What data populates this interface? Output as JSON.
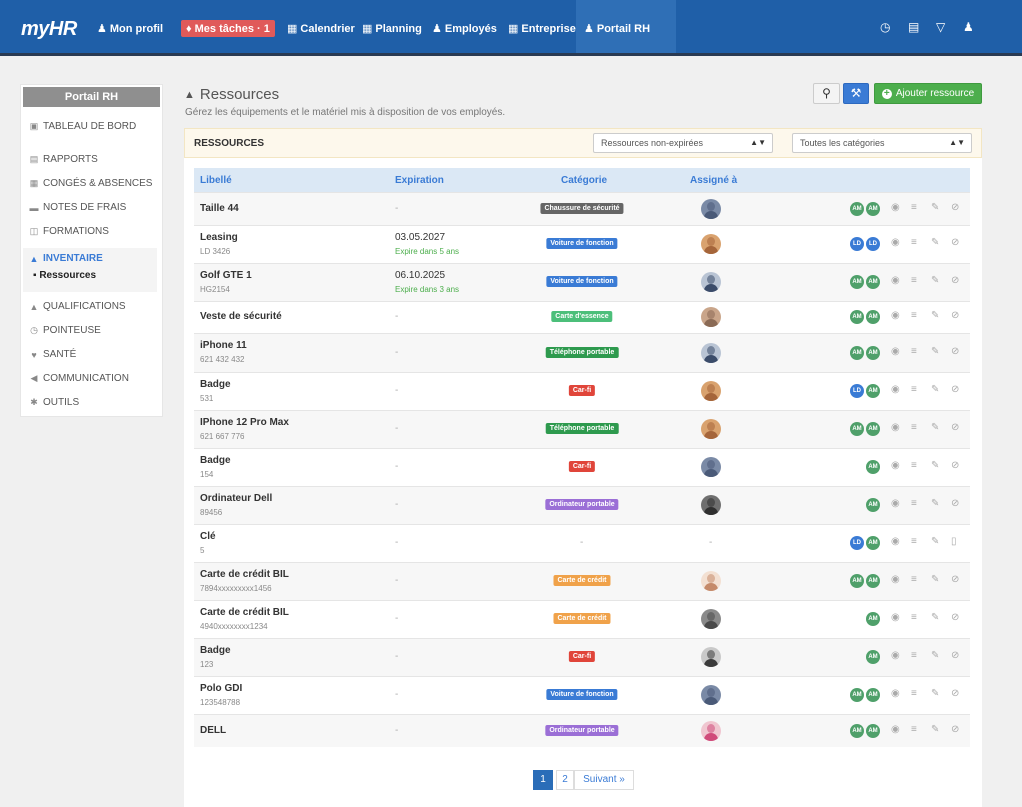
{
  "nav": {
    "logo": "myHR",
    "items": [
      {
        "label": "Mon profil",
        "icon": "user-icon"
      },
      {
        "label": "Mes tâches · 1",
        "icon": "bell-icon"
      },
      {
        "label": "Calendrier",
        "icon": "calendar-icon"
      },
      {
        "label": "Planning",
        "icon": "planning-icon"
      },
      {
        "label": "Employés",
        "icon": "users-icon"
      },
      {
        "label": "Entreprise",
        "icon": "building-icon"
      },
      {
        "label": "Portail RH",
        "icon": "hr-portal-icon"
      }
    ],
    "right_icons": [
      "alarm-icon",
      "clipboard-icon",
      "filter-icon",
      "user-icon"
    ]
  },
  "sidebar": {
    "title": "Portail RH",
    "items": [
      {
        "label": "TABLEAU DE BORD"
      },
      {
        "label": "RAPPORTS"
      },
      {
        "label": "CONGÉS & ABSENCES"
      },
      {
        "label": "NOTES DE FRAIS"
      },
      {
        "label": "FORMATIONS"
      },
      {
        "label": "INVENTAIRE"
      },
      {
        "label": "QUALIFICATIONS"
      },
      {
        "label": "POINTEUSE"
      },
      {
        "label": "SANTÉ"
      },
      {
        "label": "COMMUNICATION"
      },
      {
        "label": "OUTILS"
      }
    ],
    "sub_item": "Ressources"
  },
  "header": {
    "title": "Ressources",
    "subtitle": "Gérez les équipements et le matériel mis à disposition de vos employés.",
    "add_button": "Ajouter ressource"
  },
  "panel": {
    "title": "RESSOURCES",
    "filter_status": "Ressources non-expirées",
    "filter_category": "Toutes les catégories"
  },
  "table": {
    "columns": [
      "Libellé",
      "Expiration",
      "Catégorie",
      "Assigné à"
    ],
    "rows": [
      {
        "name": "Taille 44",
        "sub": "",
        "exp": "-",
        "exp2": "",
        "cat": "Chaussure de sécurité",
        "cat_color": "#666666",
        "chips": [
          "AM",
          "AM"
        ],
        "last_icon": "ban"
      },
      {
        "name": "Leasing",
        "sub": "LD 3426",
        "exp": "03.05.2027",
        "exp2": "Expire dans 5 ans",
        "cat": "Voiture de fonction",
        "cat_color": "#3a7bd5",
        "chips": [
          "LD",
          "LD"
        ],
        "last_icon": "ban"
      },
      {
        "name": "Golf GTE 1",
        "sub": "HG2154",
        "exp": "06.10.2025",
        "exp2": "Expire dans 3 ans",
        "cat": "Voiture de fonction",
        "cat_color": "#3a7bd5",
        "chips": [
          "AM",
          "AM"
        ],
        "last_icon": "ban"
      },
      {
        "name": "Veste de sécurité",
        "sub": "",
        "exp": "-",
        "exp2": "",
        "cat": "Carte d'essence",
        "cat_color": "#4cbf7a",
        "chips": [
          "AM",
          "AM"
        ],
        "last_icon": "ban"
      },
      {
        "name": "iPhone 11",
        "sub": "621 432 432",
        "exp": "-",
        "exp2": "",
        "cat": "Téléphone portable",
        "cat_color": "#2e9a4e",
        "chips": [
          "AM",
          "AM"
        ],
        "last_icon": "ban"
      },
      {
        "name": "Badge",
        "sub": "531",
        "exp": "-",
        "exp2": "",
        "cat": "Car-fi",
        "cat_color": "#e0453a",
        "chips": [
          "LD",
          "AM"
        ],
        "last_icon": "ban"
      },
      {
        "name": "IPhone 12 Pro Max",
        "sub": "621 667 776",
        "exp": "-",
        "exp2": "",
        "cat": "Téléphone portable",
        "cat_color": "#2e9a4e",
        "chips": [
          "AM",
          "AM"
        ],
        "last_icon": "ban"
      },
      {
        "name": "Badge",
        "sub": "154",
        "exp": "-",
        "exp2": "",
        "cat": "Car-fi",
        "cat_color": "#e0453a",
        "chips": [
          "AM"
        ],
        "last_icon": "ban"
      },
      {
        "name": "Ordinateur Dell",
        "sub": "89456",
        "exp": "-",
        "exp2": "",
        "cat": "Ordinateur portable",
        "cat_color": "#9b6fd6",
        "chips": [
          "AM"
        ],
        "last_icon": "ban"
      },
      {
        "name": "Clé",
        "sub": "5",
        "exp": "-",
        "exp2": "",
        "cat": "-",
        "cat_color": "",
        "assigned_dash": "-",
        "chips": [
          "LD",
          "AM"
        ],
        "last_icon": "trash"
      },
      {
        "name": "Carte de crédit BIL",
        "sub": "7894xxxxxxxxx1456",
        "exp": "-",
        "exp2": "",
        "cat": "Carte de crédit",
        "cat_color": "#f0a24a",
        "chips": [
          "AM",
          "AM"
        ],
        "last_icon": "ban"
      },
      {
        "name": "Carte de crédit BIL",
        "sub": "4940xxxxxxxx1234",
        "exp": "-",
        "exp2": "",
        "cat": "Carte de crédit",
        "cat_color": "#f0a24a",
        "chips": [
          "AM"
        ],
        "last_icon": "ban"
      },
      {
        "name": "Badge",
        "sub": "123",
        "exp": "-",
        "exp2": "",
        "cat": "Car-fi",
        "cat_color": "#e0453a",
        "chips": [
          "AM"
        ],
        "last_icon": "ban"
      },
      {
        "name": "Polo GDI",
        "sub": "123548788",
        "exp": "-",
        "exp2": "",
        "cat": "Voiture de fonction",
        "cat_color": "#3a7bd5",
        "chips": [
          "AM",
          "AM"
        ],
        "last_icon": "ban"
      },
      {
        "name": "DELL",
        "sub": "",
        "exp": "-",
        "exp2": "",
        "cat": "Ordinateur portable",
        "cat_color": "#9b6fd6",
        "chips": [
          "AM",
          "AM"
        ],
        "last_icon": "ban"
      }
    ]
  },
  "pagination": {
    "pages": [
      "1",
      "2"
    ],
    "next": "Suivant »"
  },
  "colors": {
    "brand": "#1f5fa8",
    "accent": "#3a7bd5",
    "success": "#4cae4c",
    "chip_am": "#4fa06a",
    "chip_ld": "#3a7bd5"
  }
}
